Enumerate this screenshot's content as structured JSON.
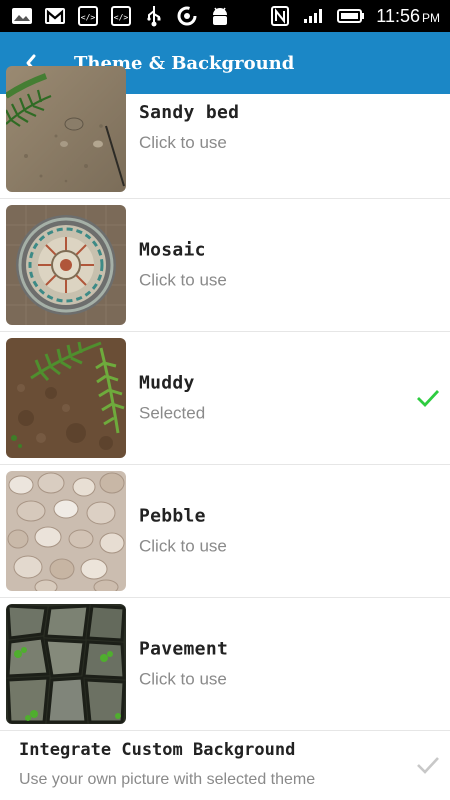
{
  "status_bar": {
    "time": "11:56",
    "ampm": "PM",
    "icons": [
      "gallery-icon",
      "gmail-icon",
      "code-icon",
      "code-icon",
      "usb-icon",
      "sync-icon",
      "android-icon",
      "nfc-icon",
      "signal-icon",
      "battery-icon"
    ]
  },
  "app_bar": {
    "title": "Theme & Background",
    "back_icon": "chevron-left-icon"
  },
  "themes": [
    {
      "name": "Sandy bed",
      "status": "Click to use",
      "selected": false
    },
    {
      "name": "Mosaic",
      "status": "Click to use",
      "selected": false
    },
    {
      "name": "Muddy",
      "status": "Selected",
      "selected": true
    },
    {
      "name": "Pebble",
      "status": "Click to use",
      "selected": false
    },
    {
      "name": "Pavement",
      "status": "Click to use",
      "selected": false
    }
  ],
  "custom": {
    "title": "Integrate Custom Background",
    "subtitle": "Use your own picture with selected theme",
    "checked": false
  },
  "colors": {
    "accent": "#1b87c6",
    "selected_check": "#2ecc40",
    "unchecked": "#c8c8c8"
  }
}
